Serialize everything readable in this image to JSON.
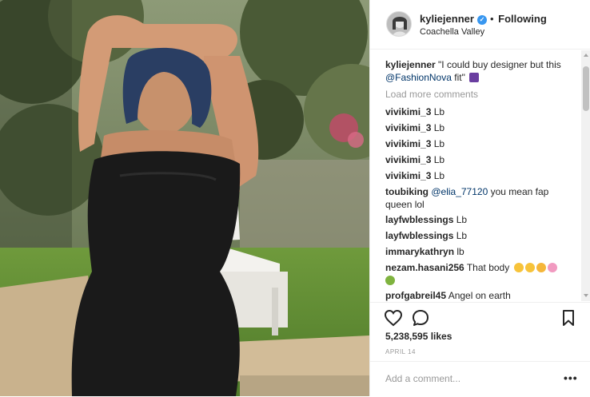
{
  "post": {
    "username": "kyliejenner",
    "verified_icon": "verified-badge-icon",
    "separator": "•",
    "follow_label": "Following",
    "location": "Coachella Valley"
  },
  "caption": {
    "username": "kyliejenner",
    "text": "\"I could buy designer but this",
    "mention": "@FashionNova",
    "text_end": "fit\"",
    "emoji_icon": "purple-dress-emoji"
  },
  "load_more_label": "Load more comments",
  "comments": [
    {
      "user": "vivikimi_3",
      "text": "Lb"
    },
    {
      "user": "vivikimi_3",
      "text": "Lb"
    },
    {
      "user": "vivikimi_3",
      "text": "Lb"
    },
    {
      "user": "vivikimi_3",
      "text": "Lb"
    },
    {
      "user": "vivikimi_3",
      "text": "Lb"
    },
    {
      "user": "toubiking",
      "mention": "@elia_77120",
      "text": "you mean fap",
      "text_line2": "queen lol"
    },
    {
      "user": "layfwblessings",
      "text": "Lb"
    },
    {
      "user": "layfwblessings",
      "text": "Lb"
    },
    {
      "user": "immarykathryn",
      "text": "lb"
    },
    {
      "user": "nezam.hasani256",
      "text": "That body",
      "emojis": [
        "heart-eyes-emoji",
        "heart-eyes-emoji",
        "smile-emoji",
        "flower-emoji",
        "bouquet-emoji"
      ]
    },
    {
      "user": "profgabreil45",
      "text": "Angel on earth"
    }
  ],
  "actions": {
    "like_icon": "heart-icon",
    "comment_icon": "comment-bubble-icon",
    "save_icon": "bookmark-icon"
  },
  "likes": "5,238,595 likes",
  "date": "APRIL 14",
  "comment_box": {
    "placeholder": "Add a comment...",
    "more_label": "•••"
  },
  "colors": {
    "mention": "#003569",
    "verified": "#3897f0",
    "muted": "#999999",
    "border": "#efefef"
  }
}
